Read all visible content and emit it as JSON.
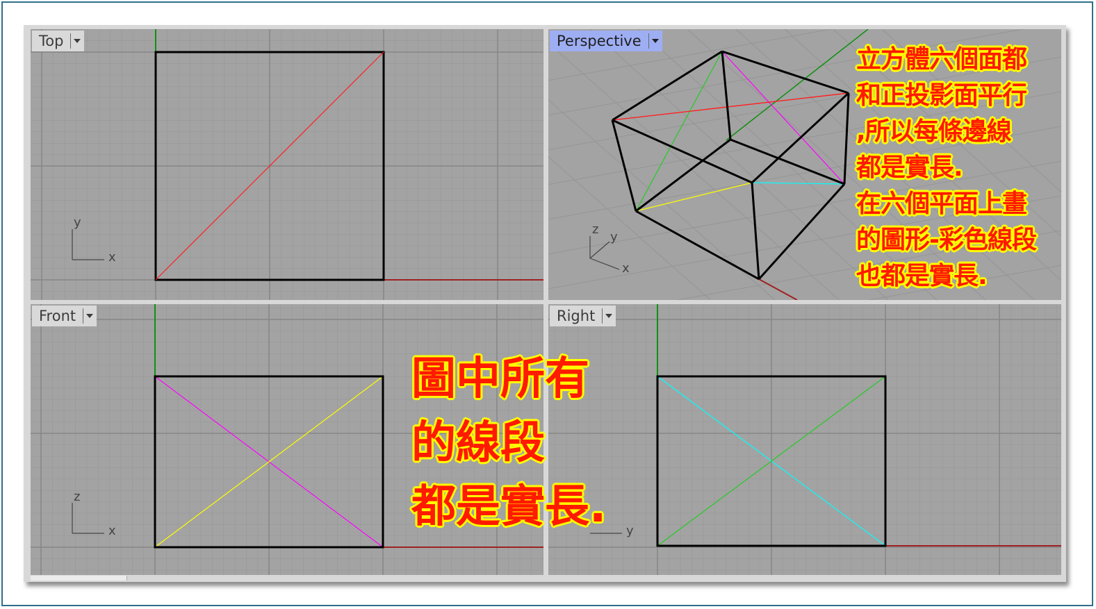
{
  "viewports": {
    "top": {
      "label": "Top",
      "axis_a": "y",
      "axis_b": "x"
    },
    "perspective": {
      "label": "Perspective",
      "axis_z": "z",
      "axis_y": "y",
      "axis_x": "x"
    },
    "front": {
      "label": "Front",
      "axis_a": "z",
      "axis_b": "x"
    },
    "right": {
      "label": "Right",
      "axis_b": "y"
    }
  },
  "annotations": {
    "right_note": [
      "立方體六個面都",
      "和正投影面平行",
      ",所以每條邊線",
      "都是實長.",
      "在六個平面上畫",
      "的圖形-彩色線段",
      "也都是實長."
    ],
    "center_note": [
      "圖中所有",
      "的線段",
      "都是實長."
    ]
  },
  "colors": {
    "viewport_bg": "#a3a3a3",
    "grid_minor": "#959595",
    "grid_major": "#858585",
    "edge": "#000000",
    "red": "#ff2020",
    "magenta": "#ff00ff",
    "yellow": "#ffff00",
    "cyan": "#00ffff",
    "green": "#22cc22",
    "axis_red": "#a02020",
    "axis_green": "#109010",
    "note_text": "#ff1a00",
    "note_outline": "#ffff00",
    "active_tab": "#9eaef3"
  },
  "icons": [
    "dropdown-arrow-icon",
    "axis-gizmo-icon"
  ]
}
